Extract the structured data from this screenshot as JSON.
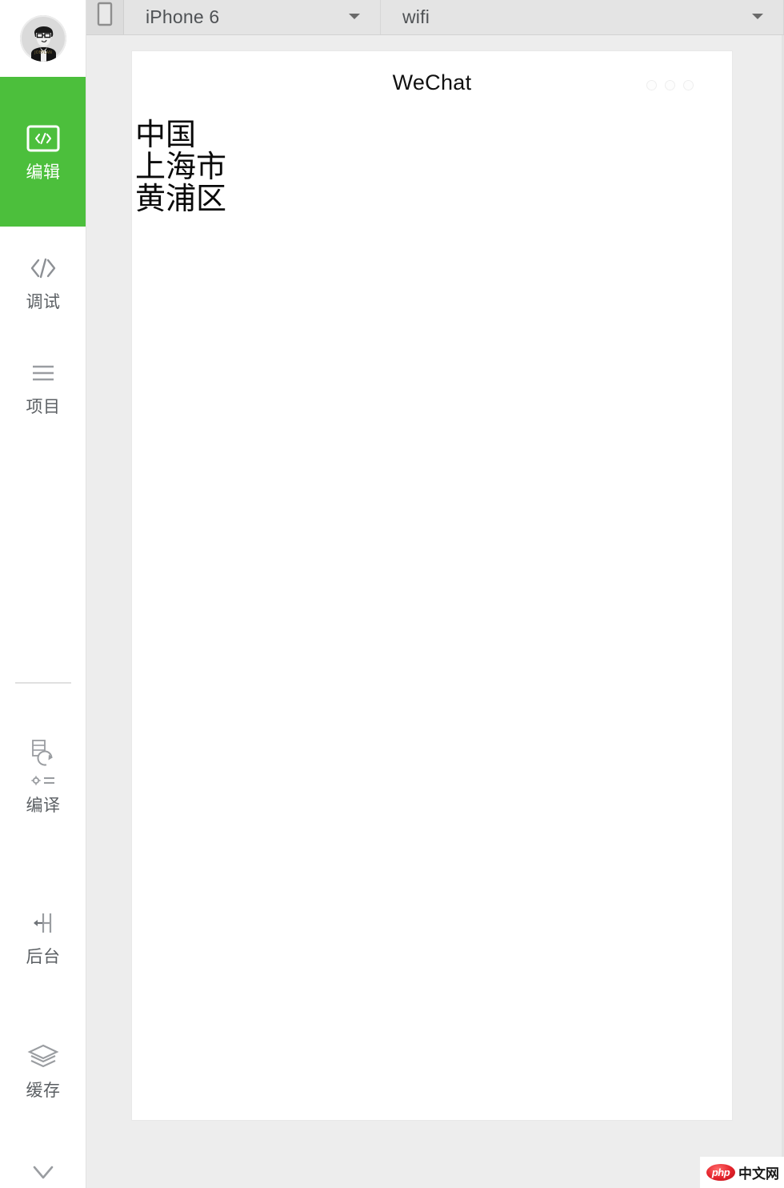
{
  "colors": {
    "accent_green": "#4CBF3C",
    "sidebar_bg": "#FFFFFF",
    "workspace_bg": "#EDEDED",
    "toolbar_bg": "#E4E4E4",
    "label_gray": "#5B5F63",
    "panel_bg": "#FFFFFF",
    "watermark_red": "#E4222A"
  },
  "sidebar": {
    "avatar": {
      "icon": "user-avatar-photo",
      "alt": "user avatar"
    },
    "items": [
      {
        "label": "编辑",
        "icon": "code-window-icon",
        "active": true
      },
      {
        "label": "调试",
        "icon": "angle-brackets-icon",
        "active": false
      },
      {
        "label": "项目",
        "icon": "list-lines-icon",
        "active": false
      },
      {
        "label": "编译",
        "icon": "recompile-refresh-icon",
        "sub_icon": "gear-lines-icon",
        "active": false
      },
      {
        "label": "后台",
        "icon": "background-arrow-bar-icon",
        "active": false
      },
      {
        "label": "缓存",
        "icon": "layers-stack-icon",
        "active": false
      }
    ],
    "more": {
      "icon": "chevron-down-icon"
    }
  },
  "toolbar": {
    "device_toggle": {
      "icon": "phone-outline-icon"
    },
    "device_select": {
      "value": "iPhone 6",
      "caret": "caret-down-icon"
    },
    "network_select": {
      "value": "wifi",
      "caret": "caret-down-icon"
    }
  },
  "simulator": {
    "title": "WeChat",
    "menu_dots": {
      "icon": "three-dots-icon",
      "count": 3
    },
    "content_lines": [
      "中国",
      "上海市",
      "黄浦区"
    ]
  },
  "watermark": {
    "logo_text": "php",
    "text": "中文网"
  }
}
